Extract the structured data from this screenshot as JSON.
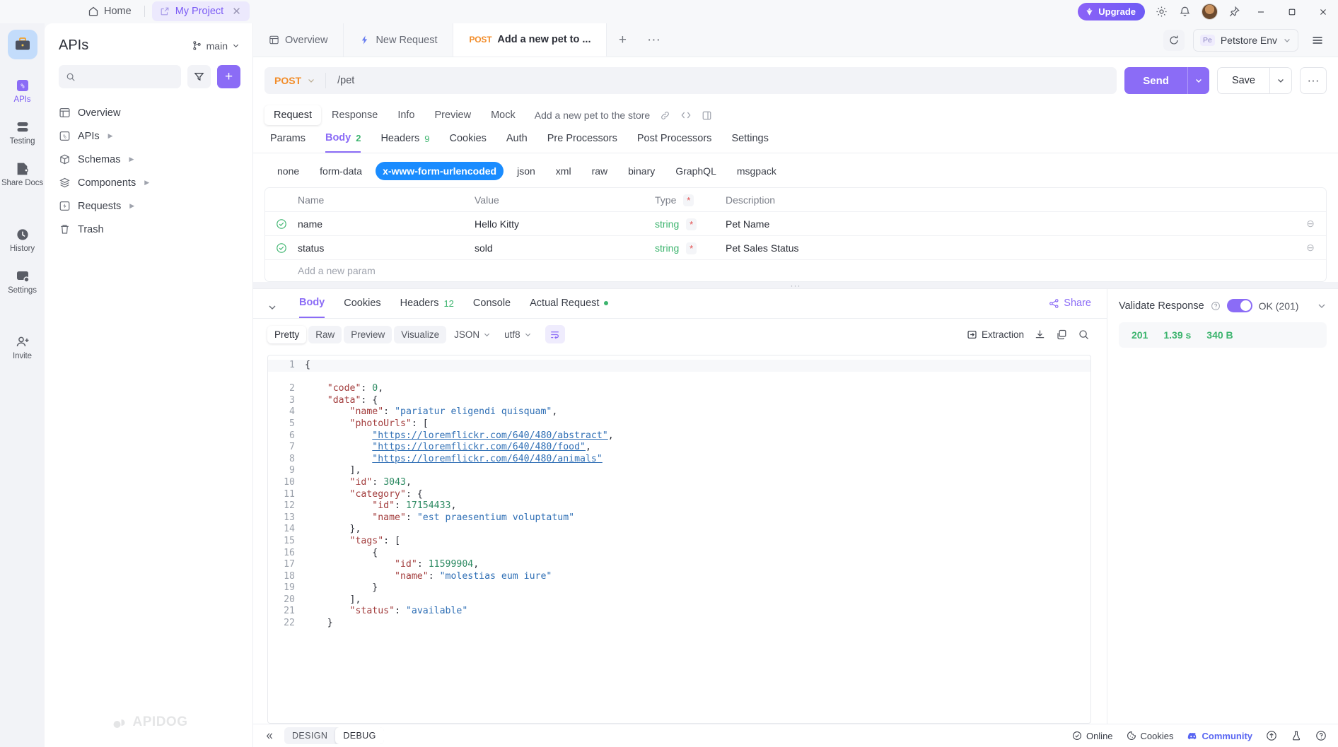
{
  "titlebar": {
    "home_label": "Home",
    "project_tab": "My Project",
    "project_close": "✕",
    "upgrade_label": "Upgrade",
    "icons": [
      "upgrade-icon",
      "settings-gear-icon",
      "bell-icon",
      "avatar",
      "pin-icon",
      "minimize",
      "maximize",
      "close"
    ]
  },
  "rail": {
    "items": [
      {
        "label": "APIs",
        "icon": "apis-icon",
        "active": true
      },
      {
        "label": "Testing",
        "icon": "testing-icon",
        "active": false
      },
      {
        "label": "Share Docs",
        "icon": "share-docs-icon",
        "active": false
      },
      {
        "label": "History",
        "icon": "history-icon",
        "active": false
      },
      {
        "label": "Settings",
        "icon": "settings-icon",
        "active": false
      },
      {
        "label": "Invite",
        "icon": "invite-icon",
        "active": false
      }
    ]
  },
  "sidebar": {
    "title": "APIs",
    "branch": "main",
    "search_placeholder": "",
    "filter_icon": "filter-icon",
    "add_label": "+",
    "tree": [
      {
        "label": "Overview",
        "icon": "overview-icon",
        "expandable": false
      },
      {
        "label": "APIs",
        "icon": "apis-folder-icon",
        "expandable": true
      },
      {
        "label": "Schemas",
        "icon": "schemas-icon",
        "expandable": true
      },
      {
        "label": "Components",
        "icon": "components-icon",
        "expandable": true
      },
      {
        "label": "Requests",
        "icon": "requests-icon",
        "expandable": true
      },
      {
        "label": "Trash",
        "icon": "trash-icon",
        "expandable": false
      }
    ],
    "watermark": "APIDOG"
  },
  "tabstrip": {
    "tabs": [
      {
        "label": "Overview",
        "icon": "overview-icon",
        "method": "",
        "active": false
      },
      {
        "label": "New Request",
        "icon": "lightning-icon",
        "method": "",
        "active": false
      },
      {
        "label": "Add a new pet to ...",
        "icon": "",
        "method": "POST",
        "active": true
      }
    ],
    "plus": "+",
    "more": "···",
    "refresh_icon": "refresh-icon",
    "env_badge": "Pe",
    "env_name": "Petstore Env",
    "hamburger_icon": "hamburger-icon"
  },
  "urlbar": {
    "method": "POST",
    "url": "/pet",
    "send_label": "Send",
    "save_label": "Save",
    "more_label": "···"
  },
  "request": {
    "tabs": [
      {
        "label": "Request",
        "active": true
      },
      {
        "label": "Response",
        "active": false
      },
      {
        "label": "Info",
        "active": false
      },
      {
        "label": "Preview",
        "active": false
      },
      {
        "label": "Mock",
        "active": false
      }
    ],
    "description": "Add a new pet to the store",
    "desc_icons": [
      "link-icon",
      "code-icon",
      "panel-icon"
    ],
    "body_tabs": [
      {
        "label": "Params",
        "count": "",
        "active": false
      },
      {
        "label": "Body",
        "count": "2",
        "active": true
      },
      {
        "label": "Headers",
        "count": "9",
        "active": false
      },
      {
        "label": "Cookies",
        "count": "",
        "active": false
      },
      {
        "label": "Auth",
        "count": "",
        "active": false
      },
      {
        "label": "Pre Processors",
        "count": "",
        "active": false
      },
      {
        "label": "Post Processors",
        "count": "",
        "active": false
      },
      {
        "label": "Settings",
        "count": "",
        "active": false
      }
    ],
    "mime_types": [
      {
        "label": "none",
        "active": false
      },
      {
        "label": "form-data",
        "active": false
      },
      {
        "label": "x-www-form-urlencoded",
        "active": true
      },
      {
        "label": "json",
        "active": false
      },
      {
        "label": "xml",
        "active": false
      },
      {
        "label": "raw",
        "active": false
      },
      {
        "label": "binary",
        "active": false
      },
      {
        "label": "GraphQL",
        "active": false
      },
      {
        "label": "msgpack",
        "active": false
      }
    ],
    "table": {
      "headers": {
        "name": "Name",
        "value": "Value",
        "type": "Type",
        "type_star": "*",
        "description": "Description"
      },
      "rows": [
        {
          "checked": true,
          "name": "name",
          "value": "Hello Kitty",
          "type": "string",
          "star": "*",
          "description": "Pet Name",
          "remove": "⊖"
        },
        {
          "checked": true,
          "name": "status",
          "value": "sold",
          "type": "string",
          "star": "*",
          "description": "Pet Sales Status",
          "remove": "⊖"
        }
      ],
      "add_row": "Add a new param"
    }
  },
  "response": {
    "tabs": [
      {
        "label": "Body",
        "count": "",
        "dot": false,
        "active": true
      },
      {
        "label": "Cookies",
        "count": "",
        "dot": false,
        "active": false
      },
      {
        "label": "Headers",
        "count": "12",
        "dot": false,
        "active": false
      },
      {
        "label": "Console",
        "count": "",
        "dot": false,
        "active": false
      },
      {
        "label": "Actual Request",
        "count": "",
        "dot": true,
        "active": false
      }
    ],
    "share_label": "Share",
    "view_modes": [
      {
        "label": "Pretty",
        "active": true
      },
      {
        "label": "Raw",
        "active": false
      },
      {
        "label": "Preview",
        "active": false
      },
      {
        "label": "Visualize",
        "active": false
      }
    ],
    "format_select": "JSON",
    "charset_select": "utf8",
    "wrap_icon": "wrap-lines-icon",
    "extraction_label": "Extraction",
    "toolbar_icons": [
      "download-icon",
      "copy-icon",
      "search-icon"
    ],
    "validate": {
      "label": "Validate Response",
      "help_icon": "help-icon",
      "enabled": true,
      "status_text": "OK (201)",
      "caret_icon": "chevron-down-icon"
    },
    "stats": {
      "code": "201",
      "time": "1.39 s",
      "size": "340 B"
    },
    "code_lines": [
      {
        "n": 1,
        "tokens": [
          {
            "t": "p",
            "v": "{"
          }
        ]
      },
      {
        "n": 2,
        "tokens": [
          {
            "t": "p",
            "v": "    "
          },
          {
            "t": "k",
            "v": "\"code\""
          },
          {
            "t": "p",
            "v": ": "
          },
          {
            "t": "n",
            "v": "0"
          },
          {
            "t": "p",
            "v": ","
          }
        ]
      },
      {
        "n": 3,
        "tokens": [
          {
            "t": "p",
            "v": "    "
          },
          {
            "t": "k",
            "v": "\"data\""
          },
          {
            "t": "p",
            "v": ": {"
          }
        ]
      },
      {
        "n": 4,
        "tokens": [
          {
            "t": "p",
            "v": "        "
          },
          {
            "t": "k",
            "v": "\"name\""
          },
          {
            "t": "p",
            "v": ": "
          },
          {
            "t": "s",
            "v": "\"pariatur eligendi quisquam\""
          },
          {
            "t": "p",
            "v": ","
          }
        ]
      },
      {
        "n": 5,
        "tokens": [
          {
            "t": "p",
            "v": "        "
          },
          {
            "t": "k",
            "v": "\"photoUrls\""
          },
          {
            "t": "p",
            "v": ": ["
          }
        ]
      },
      {
        "n": 6,
        "tokens": [
          {
            "t": "p",
            "v": "            "
          },
          {
            "t": "u",
            "v": "\"https://loremflickr.com/640/480/abstract\""
          },
          {
            "t": "p",
            "v": ","
          }
        ]
      },
      {
        "n": 7,
        "tokens": [
          {
            "t": "p",
            "v": "            "
          },
          {
            "t": "u",
            "v": "\"https://loremflickr.com/640/480/food\""
          },
          {
            "t": "p",
            "v": ","
          }
        ]
      },
      {
        "n": 8,
        "tokens": [
          {
            "t": "p",
            "v": "            "
          },
          {
            "t": "u",
            "v": "\"https://loremflickr.com/640/480/animals\""
          }
        ]
      },
      {
        "n": 9,
        "tokens": [
          {
            "t": "p",
            "v": "        ],"
          }
        ]
      },
      {
        "n": 10,
        "tokens": [
          {
            "t": "p",
            "v": "        "
          },
          {
            "t": "k",
            "v": "\"id\""
          },
          {
            "t": "p",
            "v": ": "
          },
          {
            "t": "n",
            "v": "3043"
          },
          {
            "t": "p",
            "v": ","
          }
        ]
      },
      {
        "n": 11,
        "tokens": [
          {
            "t": "p",
            "v": "        "
          },
          {
            "t": "k",
            "v": "\"category\""
          },
          {
            "t": "p",
            "v": ": {"
          }
        ]
      },
      {
        "n": 12,
        "tokens": [
          {
            "t": "p",
            "v": "            "
          },
          {
            "t": "k",
            "v": "\"id\""
          },
          {
            "t": "p",
            "v": ": "
          },
          {
            "t": "n",
            "v": "17154433"
          },
          {
            "t": "p",
            "v": ","
          }
        ]
      },
      {
        "n": 13,
        "tokens": [
          {
            "t": "p",
            "v": "            "
          },
          {
            "t": "k",
            "v": "\"name\""
          },
          {
            "t": "p",
            "v": ": "
          },
          {
            "t": "s",
            "v": "\"est praesentium voluptatum\""
          }
        ]
      },
      {
        "n": 14,
        "tokens": [
          {
            "t": "p",
            "v": "        },"
          }
        ]
      },
      {
        "n": 15,
        "tokens": [
          {
            "t": "p",
            "v": "        "
          },
          {
            "t": "k",
            "v": "\"tags\""
          },
          {
            "t": "p",
            "v": ": ["
          }
        ]
      },
      {
        "n": 16,
        "tokens": [
          {
            "t": "p",
            "v": "            {"
          }
        ]
      },
      {
        "n": 17,
        "tokens": [
          {
            "t": "p",
            "v": "                "
          },
          {
            "t": "k",
            "v": "\"id\""
          },
          {
            "t": "p",
            "v": ": "
          },
          {
            "t": "n",
            "v": "11599904"
          },
          {
            "t": "p",
            "v": ","
          }
        ]
      },
      {
        "n": 18,
        "tokens": [
          {
            "t": "p",
            "v": "                "
          },
          {
            "t": "k",
            "v": "\"name\""
          },
          {
            "t": "p",
            "v": ": "
          },
          {
            "t": "s",
            "v": "\"molestias eum iure\""
          }
        ]
      },
      {
        "n": 19,
        "tokens": [
          {
            "t": "p",
            "v": "            }"
          }
        ]
      },
      {
        "n": 20,
        "tokens": [
          {
            "t": "p",
            "v": "        ],"
          }
        ]
      },
      {
        "n": 21,
        "tokens": [
          {
            "t": "p",
            "v": "        "
          },
          {
            "t": "k",
            "v": "\"status\""
          },
          {
            "t": "p",
            "v": ": "
          },
          {
            "t": "s",
            "v": "\"available\""
          }
        ]
      },
      {
        "n": 22,
        "tokens": [
          {
            "t": "p",
            "v": "    }"
          }
        ]
      }
    ]
  },
  "bottom": {
    "collapse_icon": "collapse-left-icon",
    "modes": [
      {
        "label": "DESIGN",
        "active": false
      },
      {
        "label": "DEBUG",
        "active": true
      }
    ],
    "status": [
      {
        "label": "Online",
        "icon": "online-icon"
      },
      {
        "label": "Cookies",
        "icon": "cookies-icon"
      },
      {
        "label": "Community",
        "icon": "discord-icon"
      }
    ],
    "icons": [
      "upload-icon",
      "flask-icon",
      "help-icon"
    ]
  },
  "colors": {
    "accent": "#8b6cf6",
    "method_post": "#f28c28",
    "active_mime": "#1a8cff",
    "success": "#3cb46e",
    "required": "#e34b4b"
  }
}
